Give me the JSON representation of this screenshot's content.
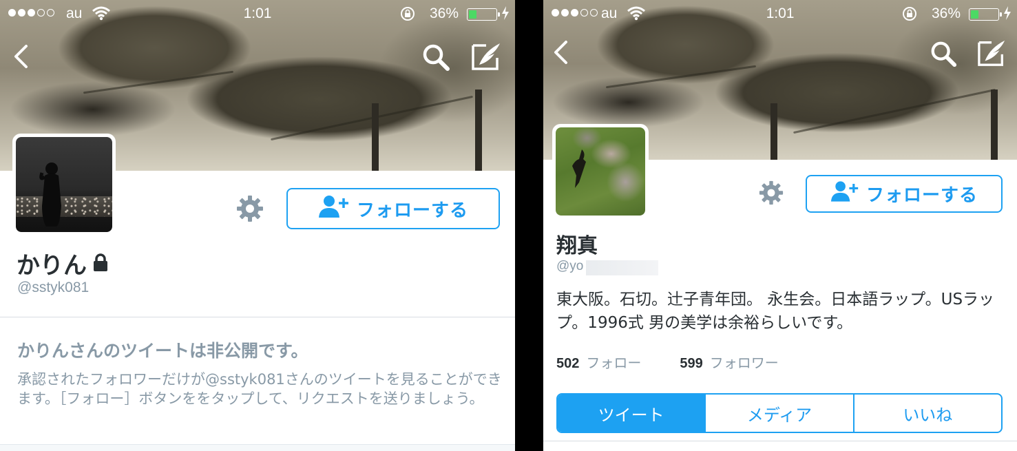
{
  "status_bar": {
    "carrier": "au",
    "time": "1:01",
    "battery_percent": "36%",
    "battery_level": 0.36,
    "signal_bars_filled": 3,
    "signal_bars_total": 5
  },
  "left": {
    "display_name": "かりん",
    "handle": "@sstyk081",
    "follow_label": "フォローする",
    "protected_title": "かりんさんのツイートは非公開です。",
    "protected_body": "承認されたフォロワーだけが@sstyk081さんのツイートを見ることができます。［フォロー］ボタンををタップして、リクエストを送りましょう。"
  },
  "right": {
    "display_name": "翔真",
    "handle_visible": "@yo",
    "follow_label": "フォローする",
    "bio": "東大阪。石切。辻子青年団。 永生会。日本語ラップ。USラップ。1996式 男の美学は余裕らしいです。",
    "stats": {
      "following_count": "502",
      "following_label": "フォロー",
      "followers_count": "599",
      "followers_label": "フォロワー"
    },
    "tabs": [
      "ツイート",
      "メディア",
      "いいね"
    ],
    "active_tab": 0
  },
  "colors": {
    "accent": "#1da1f2",
    "text_primary": "#292f33",
    "text_secondary": "#8899a6",
    "battery": "#4cd964"
  },
  "icons": [
    "back-arrow-icon",
    "search-icon",
    "compose-tweet-icon",
    "gear-icon",
    "add-user-icon",
    "lock-icon",
    "wifi-icon",
    "rotation-lock-icon",
    "charging-bolt-icon"
  ]
}
